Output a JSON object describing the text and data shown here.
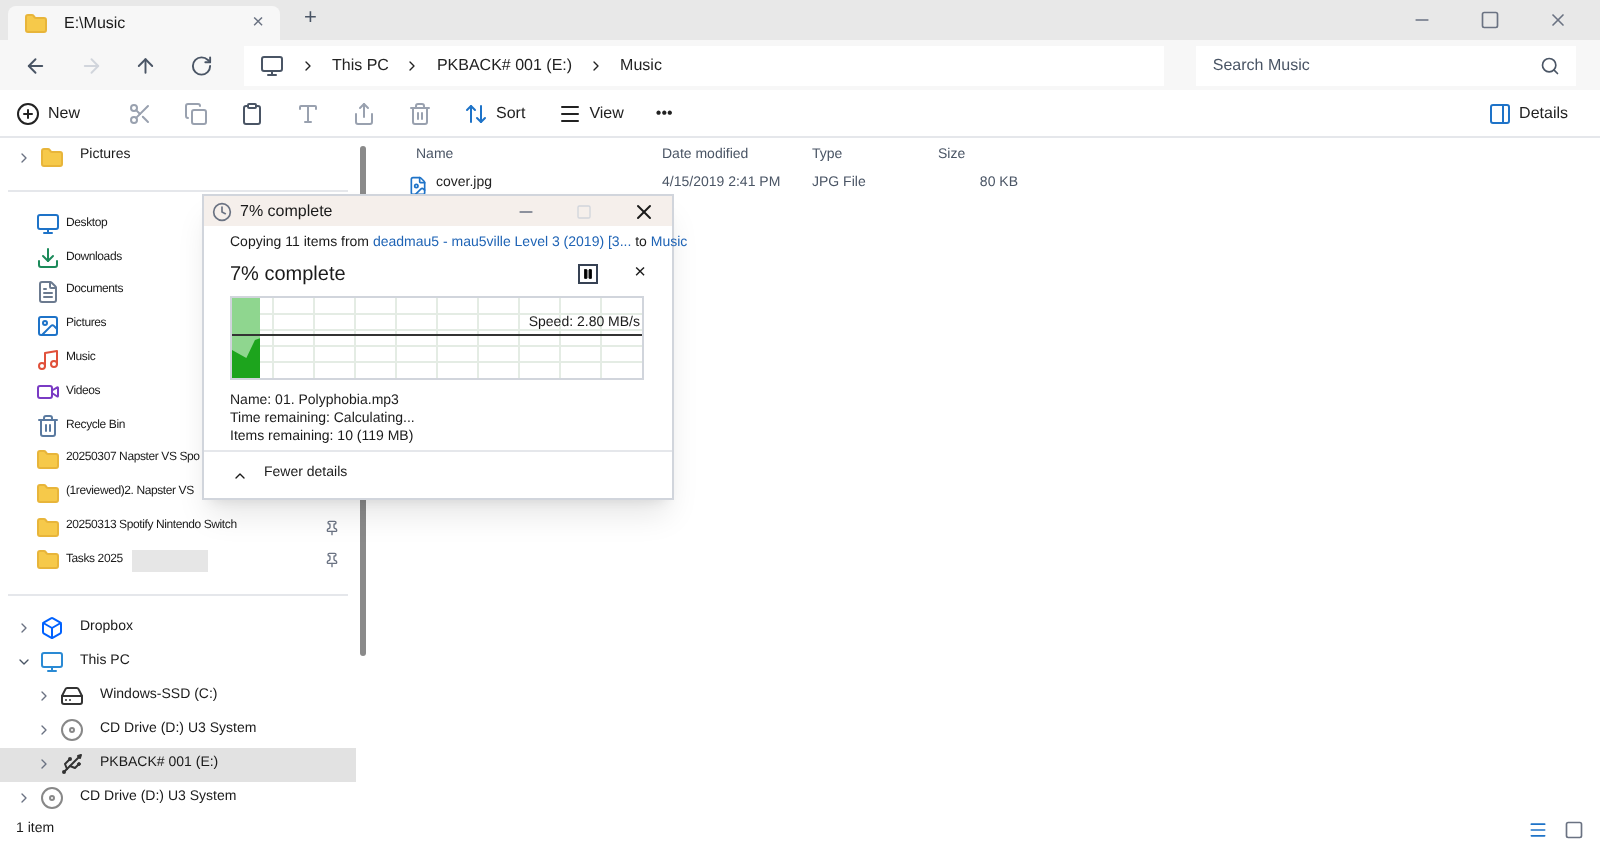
{
  "tab": {
    "title": "E:\\Music",
    "close": "×",
    "new": "+"
  },
  "breadcrumb": [
    "This PC",
    "PKBACK# 001 (E:)",
    "Music"
  ],
  "search": {
    "placeholder": "Search Music"
  },
  "commands": {
    "new": "New",
    "sort": "Sort",
    "view": "View",
    "more": "•••",
    "details": "Details"
  },
  "sidebar": {
    "top": [
      {
        "label": "Pictures",
        "kind": "folder"
      }
    ],
    "quick_access": [
      {
        "label": "Desktop",
        "kind": "desktop",
        "pinned": false,
        "redacted": false
      },
      {
        "label": "Downloads",
        "kind": "download",
        "pinned": false,
        "redacted": false
      },
      {
        "label": "Documents",
        "kind": "document",
        "pinned": false,
        "redacted": false
      },
      {
        "label": "Pictures",
        "kind": "pictures",
        "pinned": false,
        "redacted": false
      },
      {
        "label": "Music",
        "kind": "music",
        "pinned": false,
        "redacted": false
      },
      {
        "label": "Videos",
        "kind": "video",
        "pinned": false,
        "redacted": false
      },
      {
        "label": "Recycle Bin",
        "kind": "bin",
        "pinned": false,
        "redacted": false
      },
      {
        "label": "20250307 Napster VS Spo",
        "kind": "folder",
        "pinned": false,
        "redacted": false
      },
      {
        "label": "(1reviewed)2. Napster VS",
        "kind": "folder",
        "pinned": false,
        "redacted": false
      },
      {
        "label": "20250313 Spotify Nintendo Switch",
        "kind": "folder",
        "pinned": true,
        "redacted": false
      },
      {
        "label": "Tasks 2025",
        "kind": "folder",
        "pinned": true,
        "redacted": true
      }
    ],
    "tree": [
      {
        "label": "Dropbox",
        "kind": "dropbox",
        "expanded": false,
        "selected": false
      },
      {
        "label": "This PC",
        "kind": "pc",
        "expanded": true,
        "selected": false,
        "children": [
          {
            "label": "Windows-SSD (C:)",
            "kind": "ssd",
            "expanded": false,
            "selected": false
          },
          {
            "label": "CD Drive (D:) U3 System",
            "kind": "cd",
            "expanded": false,
            "selected": false
          },
          {
            "label": "PKBACK# 001 (E:)",
            "kind": "usb",
            "expanded": false,
            "selected": true
          }
        ]
      },
      {
        "label": "CD Drive (D:) U3 System",
        "kind": "cd",
        "expanded": false,
        "selected": false
      }
    ]
  },
  "table": {
    "columns": [
      "Name",
      "Date modified",
      "Type",
      "Size"
    ],
    "rows": [
      {
        "name": "cover.jpg",
        "date": "4/15/2019 2:41 PM",
        "type": "JPG File",
        "size": "80 KB"
      }
    ]
  },
  "status_bar": "1 item",
  "dialog": {
    "title": "7% complete",
    "copying": "Copying 11 items from",
    "source": "deadmau5 - mau5ville Level 3 (2019) [3...",
    "to": "to",
    "destination": "Music",
    "heading": "7% complete",
    "close": "×",
    "level": 0.07,
    "speed": "Speed: 2.80 MB/s",
    "details": [
      "Name: 01. Polyphobia.mp3",
      "Time remaining: Calculating...",
      "Items remaining: 10 (119 MB)"
    ],
    "fewer": "Fewer details"
  }
}
